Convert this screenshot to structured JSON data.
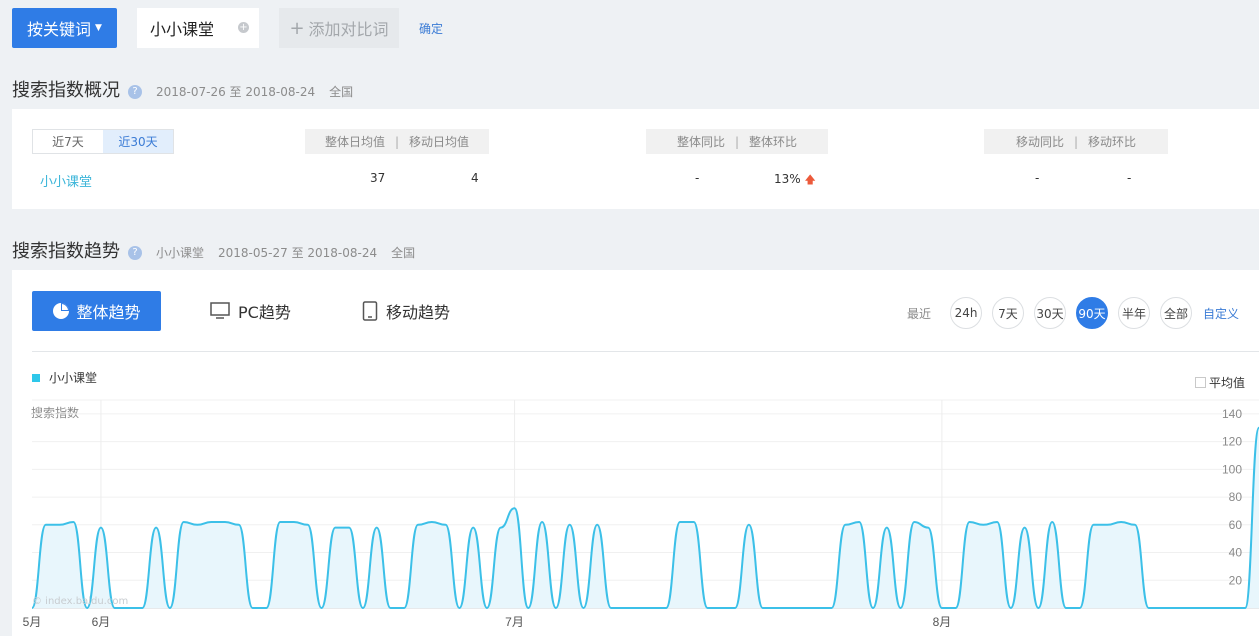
{
  "toolbar": {
    "keyword_button": "按关键词",
    "keyword_value": "小小课堂",
    "add_compare": "添加对比词",
    "confirm": "确定"
  },
  "overview": {
    "title": "搜索指数概况",
    "date_range": "2018-07-26 至 2018-08-24",
    "region": "全国",
    "range_tabs": [
      "近7天",
      "近30天"
    ],
    "active_tab": "近30天",
    "headers": {
      "avg_total": "整体日均值",
      "avg_mobile": "移动日均值",
      "yoy_total": "整体同比",
      "mom_total": "整体环比",
      "yoy_mobile": "移动同比",
      "mom_mobile": "移动环比"
    },
    "row": {
      "keyword": "小小课堂",
      "avg_total": "37",
      "avg_mobile": "4",
      "yoy_total": "-",
      "mom_total": "13%",
      "yoy_mobile": "-",
      "mom_mobile": "-"
    }
  },
  "trend": {
    "title": "搜索指数趋势",
    "keyword": "小小课堂",
    "date_range": "2018-05-27 至 2018-08-24",
    "region": "全国",
    "tabs": {
      "overall": "整体趋势",
      "pc": "PC趋势",
      "mobile": "移动趋势"
    },
    "recent_label": "最近",
    "ranges": [
      "24h",
      "7天",
      "30天",
      "90天",
      "半年",
      "全部"
    ],
    "active_range": "90天",
    "custom": "自定义",
    "legend": "小小课堂",
    "average_toggle": "平均值",
    "y_axis_label": "搜索指数",
    "watermark": "© index.baidu.com"
  },
  "colors": {
    "accent": "#2f7ce6",
    "series": "#3cc0e8",
    "series_fill": "#e8f6fc"
  },
  "chart_data": {
    "type": "area",
    "ylabel": "搜索指数",
    "ylim": [
      0,
      150
    ],
    "yticks": [
      20,
      40,
      60,
      80,
      100,
      120,
      140
    ],
    "x_start": "2018-05-27",
    "x_end": "2018-08-24",
    "x_ticks": [
      {
        "label": "5月",
        "date": "2018-05-27"
      },
      {
        "label": "6月",
        "date": "2018-06-01"
      },
      {
        "label": "7月",
        "date": "2018-07-01"
      },
      {
        "label": "8月",
        "date": "2018-08-01"
      }
    ],
    "series": [
      {
        "name": "小小课堂",
        "values": [
          0,
          60,
          60,
          62,
          0,
          58,
          0,
          0,
          0,
          58,
          0,
          62,
          60,
          62,
          62,
          60,
          0,
          0,
          62,
          62,
          60,
          0,
          58,
          58,
          0,
          58,
          0,
          0,
          60,
          62,
          60,
          0,
          58,
          0,
          58,
          72,
          0,
          62,
          0,
          60,
          0,
          60,
          0,
          0,
          0,
          0,
          0,
          62,
          62,
          0,
          0,
          0,
          60,
          0,
          0,
          0,
          0,
          0,
          0,
          60,
          62,
          0,
          58,
          0,
          62,
          58,
          0,
          0,
          62,
          60,
          62,
          0,
          58,
          0,
          62,
          0,
          0,
          60,
          60,
          62,
          60,
          0,
          0,
          0,
          0,
          0,
          0,
          0,
          0,
          130
        ]
      }
    ]
  }
}
